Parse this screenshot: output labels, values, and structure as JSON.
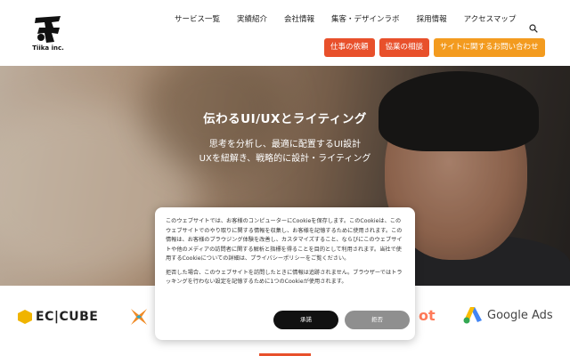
{
  "header": {
    "logo_text": "Tiika inc.",
    "nav": [
      {
        "label": "サービス一覧"
      },
      {
        "label": "実績紹介"
      },
      {
        "label": "会社情報"
      },
      {
        "label": "集客・デザインラボ"
      },
      {
        "label": "採用情報"
      },
      {
        "label": "アクセスマップ"
      }
    ],
    "search_icon": "search-icon",
    "ctas": [
      {
        "label": "仕事の依頼",
        "color": "#e8502b"
      },
      {
        "label": "協業の相談",
        "color": "#e8502b"
      },
      {
        "label": "サイトに関するお問い合わせ",
        "color": "#f39b1f"
      }
    ]
  },
  "hero": {
    "title": "伝わるUI/UXとライティング",
    "subtitle_line1": "思考を分析し、最適に配置するUI設計",
    "subtitle_line2": "UXを紐解き、戦略的に設計・ライティング"
  },
  "partner_logos": {
    "ec_cube": "EC|CUBE",
    "hubspot_fragment": "ot",
    "google_ads": "Google Ads"
  },
  "cookie_banner": {
    "paragraph1": "このウェブサイトでは、お客様のコンピューターにCookieを保存します。このCookieは、このウェブサイトでのやり取りに関する情報を収集し、お客様を記憶するために使用されます。この情報は、お客様のブラウジング体験を改善し、カスタマイズすること、ならびにこのウェブサイトや他のメディアの訪問者に関する解析と指標を得ることを目的として利用されます。当社で使用するCookieについての詳細は、プライバシーポリシーをご覧ください。",
    "paragraph2": "拒否した場合、このウェブサイトを訪問したときに情報は追跡されません。ブラウザーではトラッキングを行わない設定を記憶するために1つのCookieが使用されます。",
    "accept_label": "承諾",
    "decline_label": "拒否"
  },
  "colors": {
    "accent_orange": "#e8502b",
    "accent_amber": "#f39b1f"
  }
}
